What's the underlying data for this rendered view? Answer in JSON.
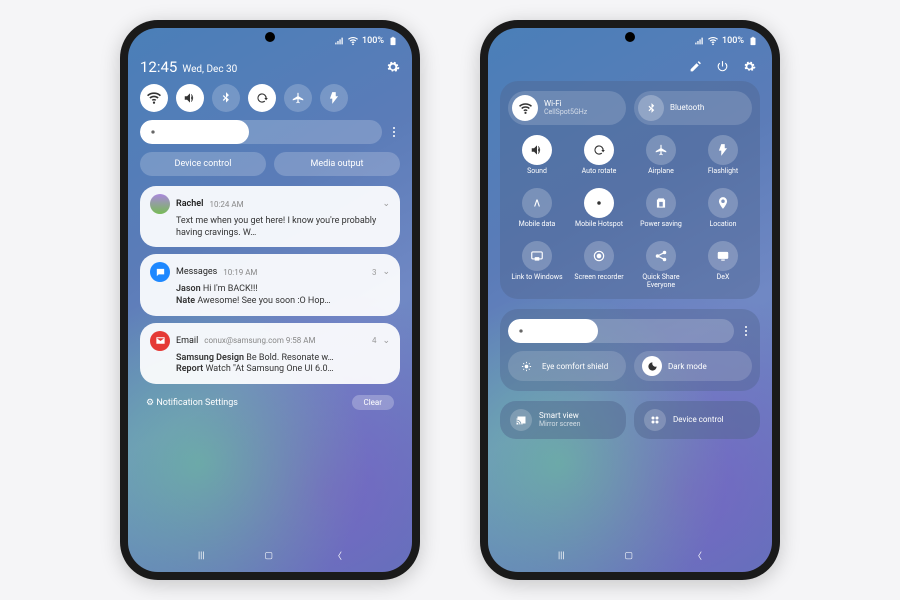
{
  "status": {
    "battery": "100%"
  },
  "left": {
    "time": "12:45",
    "date": "Wed, Dec 30",
    "buttons": {
      "device_control": "Device control",
      "media_output": "Media output"
    },
    "notifs": [
      {
        "sender": "Rachel",
        "time": "10:24 AM",
        "body": "Text me when you get here! I know you're probably having cravings. W…"
      },
      {
        "app": "Messages",
        "time": "10:19 AM",
        "count": "3",
        "line1_sender": "Jason",
        "line1_body": "Hi I'm BACK!!!",
        "line2_sender": "Nate",
        "line2_body": "Awesome! See you soon :O Hop…"
      },
      {
        "app": "Email",
        "meta": "conux@samsung.com  9:58 AM",
        "count": "4",
        "line1_sender": "Samsung Design",
        "line1_body": "Be Bold. Resonate w…",
        "line2_sender": "Report",
        "line2_body": "Watch \"At Samsung One UI 6.0…"
      }
    ],
    "footer": {
      "settings": "Notification Settings",
      "clear": "Clear"
    }
  },
  "right": {
    "wifi": {
      "label": "Wi-Fi",
      "sub": "CellSpot5GHz"
    },
    "bluetooth": {
      "label": "Bluetooth"
    },
    "grid": [
      {
        "label": "Sound",
        "on": true,
        "icon": "volume"
      },
      {
        "label": "Auto rotate",
        "on": true,
        "icon": "rotate"
      },
      {
        "label": "Airplane",
        "on": false,
        "icon": "plane"
      },
      {
        "label": "Flashlight",
        "on": false,
        "icon": "flash"
      },
      {
        "label": "Mobile data",
        "on": false,
        "icon": "data"
      },
      {
        "label": "Mobile Hotspot",
        "on": true,
        "icon": "hotspot"
      },
      {
        "label": "Power saving",
        "on": false,
        "icon": "battery"
      },
      {
        "label": "Location",
        "on": false,
        "icon": "pin"
      },
      {
        "label": "Link to Windows",
        "on": false,
        "icon": "link"
      },
      {
        "label": "Screen recorder",
        "on": false,
        "icon": "record"
      },
      {
        "label": "Quick Share Everyone",
        "on": false,
        "icon": "share"
      },
      {
        "label": "DeX",
        "on": false,
        "icon": "dex"
      }
    ],
    "eye": "Eye comfort shield",
    "dark": "Dark mode",
    "smartview": {
      "label": "Smart view",
      "sub": "Mirror screen"
    },
    "device_control": "Device control"
  }
}
